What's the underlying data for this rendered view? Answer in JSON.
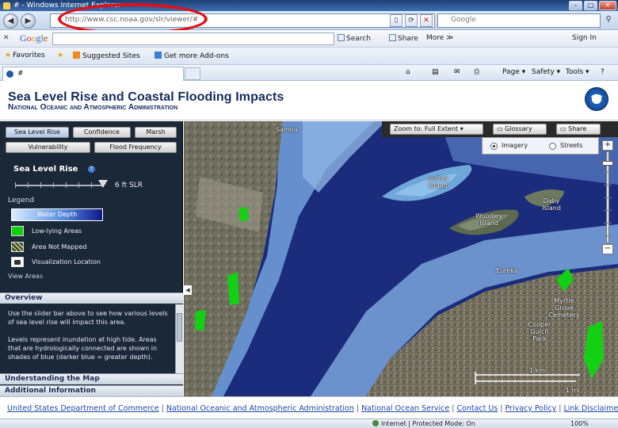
{
  "browser": {
    "title": "# - Windows Internet Explorer",
    "window_buttons": {
      "minimize": "–",
      "maximize": "□",
      "close": "✕"
    },
    "address": "http://www.csc.noaa.gov/slr/viewer/#",
    "search_placeholder": "Google",
    "google_toolbar": {
      "close": "✕",
      "logo": [
        "G",
        "o",
        "o",
        "g",
        "l",
        "e"
      ],
      "search_label": "Search",
      "share_label": "Share",
      "more_label": "More ≫",
      "sign_in_label": "Sign In"
    },
    "favorites": {
      "favorites_label": "Favorites",
      "suggested_label": "Suggested Sites",
      "addons_label": "Get more Add-ons"
    },
    "tab_title": "#",
    "commands": {
      "page": "Page",
      "safety": "Safety",
      "tools": "Tools"
    },
    "status": {
      "zone": "Internet | Protected Mode: On",
      "zoom": "100%"
    }
  },
  "page": {
    "title": "Sea Level Rise and Coastal Flooding Impacts",
    "subtitle": "National Oceanic and Atmospheric Administration"
  },
  "left_panel": {
    "tabs": [
      "Sea Level Rise",
      "Confidence",
      "Marsh",
      "Vulnerability",
      "Flood Frequency"
    ],
    "slr_label": "Sea Level Rise",
    "help": "?",
    "slider_value": "6 ft SLR",
    "slider_level_ft": 6,
    "legend_label": "Legend",
    "legend_items": {
      "water_depth": "Water Depth",
      "low_lying": "Low-lying Areas",
      "not_mapped": "Area Not Mapped",
      "viz_location": "Visualization Location"
    },
    "view_areas": "View Areas",
    "overview_title": "Overview",
    "overview_text_1": "Use the slider bar above to see how various levels of sea level rise will impact this area.",
    "overview_text_2": "Levels represent inundation at high tide. Areas that are hydrologically connected are shown in shades of blue (darker blue = greater depth).",
    "understanding_title": "Understanding the Map",
    "additional_title": "Additional Information"
  },
  "map": {
    "zoom_extent_label": "Zoom to: Full Extent",
    "glossary_label": "Glossary",
    "share_label": "Share",
    "basemap_imagery": "Imagery",
    "basemap_streets": "Streets",
    "basemap_selected": "Imagery",
    "zoom_in": "+",
    "zoom_out": "−",
    "labels": {
      "samoa": "Samoa",
      "indian_island": "Indian Island",
      "daby_island": "Daby Island",
      "woodley_island": "Woodley Island",
      "eureka": "Eureka",
      "myrtle_grove": "Myrtle Grove Cemetery",
      "cooper_gulch": "Cooper Gulch Park"
    },
    "scale_km": "1 km",
    "scale_mi": "1 mi"
  },
  "footer": {
    "links": [
      "United States Department of Commerce",
      "National Oceanic and Atmospheric Administration",
      "National Ocean Service",
      "Contact Us",
      "Privacy Policy",
      "Link Disclaimer"
    ]
  }
}
